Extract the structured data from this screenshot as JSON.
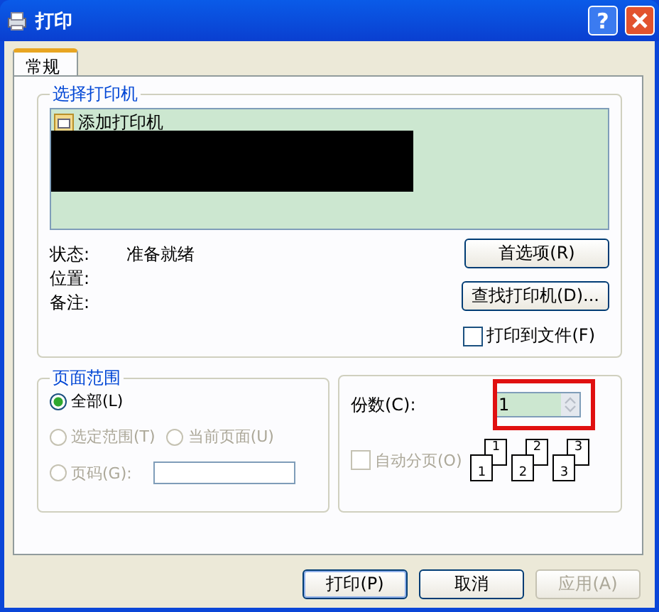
{
  "window": {
    "title": "打印",
    "help": "?"
  },
  "tabs": [
    {
      "label": "常规",
      "selected": true
    }
  ],
  "printer_group": {
    "title": "选择打印机",
    "printers": [
      {
        "name": "添加打印机"
      }
    ]
  },
  "status": [
    {
      "label": "状态:",
      "value": "准备就绪"
    },
    {
      "label": "位置:"
    },
    {
      "label": "备注:"
    }
  ],
  "side_buttons": [
    "首选项(R)",
    "查找打印机(D)..."
  ],
  "print_to_file": {
    "label": "打印到文件(F)",
    "checked": false
  },
  "page_range": {
    "title": "页面范围",
    "options": [
      {
        "label": "全部(L)",
        "selected": true,
        "disabled": false
      },
      {
        "label": "选定范围(T)",
        "selected": false,
        "disabled": true
      },
      {
        "label": "当前页面(U)",
        "selected": false,
        "disabled": true
      },
      {
        "label": "页码(G):",
        "selected": false,
        "disabled": true
      }
    ]
  },
  "copies": {
    "label": "份数(C):",
    "value": "1"
  },
  "collate": {
    "label": "自动分页(O)",
    "checked": false,
    "disabled": true,
    "pages": [
      {
        "back": "1",
        "front": "1"
      },
      {
        "back": "2",
        "front": "2"
      },
      {
        "back": "3",
        "front": "3"
      }
    ]
  },
  "footer_buttons": [
    {
      "label": "打印(P)",
      "disabled": false,
      "default": true
    },
    {
      "label": "取消",
      "disabled": false,
      "default": false
    },
    {
      "label": "应用(A)",
      "disabled": true,
      "default": false
    }
  ]
}
